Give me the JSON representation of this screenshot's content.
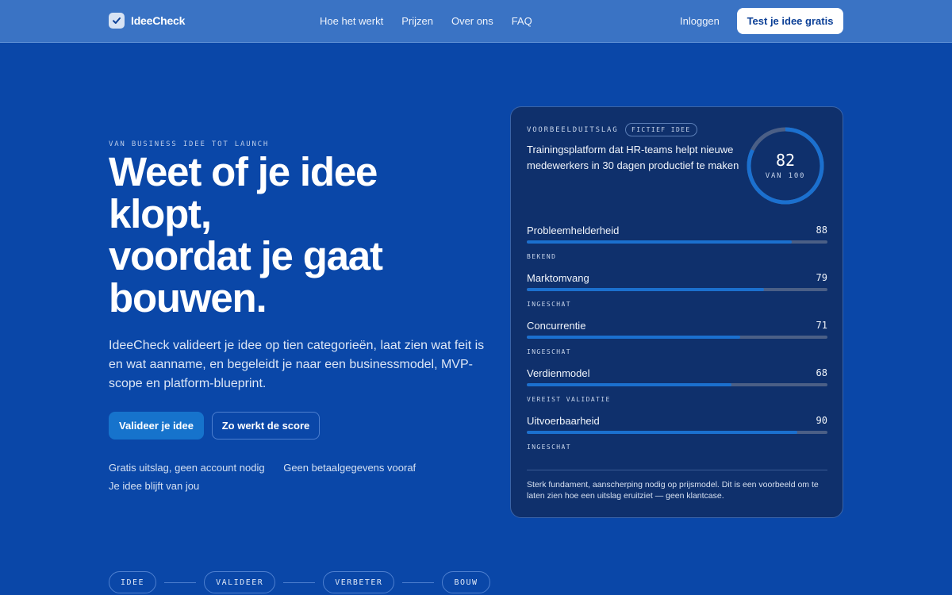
{
  "brand": {
    "name": "IdeeCheck"
  },
  "nav": {
    "links": [
      "Hoe het werkt",
      "Prijzen",
      "Over ons",
      "FAQ"
    ],
    "login": "Inloggen",
    "cta": "Test je idee gratis"
  },
  "hero": {
    "eyebrow": "VAN BUSINESS IDEE TOT LAUNCH",
    "headline_1": "Weet of je idee klopt,",
    "headline_2": "voordat je gaat bouwen.",
    "lead": "IdeeCheck valideert je idee op tien categorieën, laat zien wat feit is en wat aanname, en begeleidt je naar een businessmodel, MVP-scope en platform-blueprint.",
    "primary_button": "Valideer je idee",
    "secondary_button": "Zo werkt de score",
    "perks": [
      "Gratis uitslag, geen account nodig",
      "Geen betaalgegevens vooraf",
      "Je idee blijft van jou"
    ]
  },
  "steps": [
    "IDEE",
    "VALIDEER",
    "VERBETER",
    "BOUW"
  ],
  "card": {
    "label": "VOORBEELDUITSLAG",
    "pill": "FICTIEF IDEE",
    "title": "Trainingsplatform dat HR-teams helpt nieuwe medewerkers in 30 dagen productief te maken",
    "score": "82",
    "score_max": "VAN 100",
    "score_fraction": 0.82,
    "metrics": [
      {
        "name": "Probleemhelderheid",
        "value": "88",
        "tag": "BEKEND"
      },
      {
        "name": "Marktomvang",
        "value": "79",
        "tag": "INGESCHAT"
      },
      {
        "name": "Concurrentie",
        "value": "71",
        "tag": "INGESCHAT"
      },
      {
        "name": "Verdienmodel",
        "value": "68",
        "tag": "VEREIST VALIDATIE"
      },
      {
        "name": "Uitvoerbaarheid",
        "value": "90",
        "tag": "INGESCHAT"
      }
    ],
    "footer": "Sterk fundament, aanscherping nodig op prijsmodel. Dit is een voorbeeld om te laten zien hoe een uitslag eruitziet — geen klantcase."
  },
  "colors": {
    "background": "#0a47a8",
    "nav": "#3a73c4",
    "card": "#0f306c",
    "accent": "#1b70cf"
  }
}
